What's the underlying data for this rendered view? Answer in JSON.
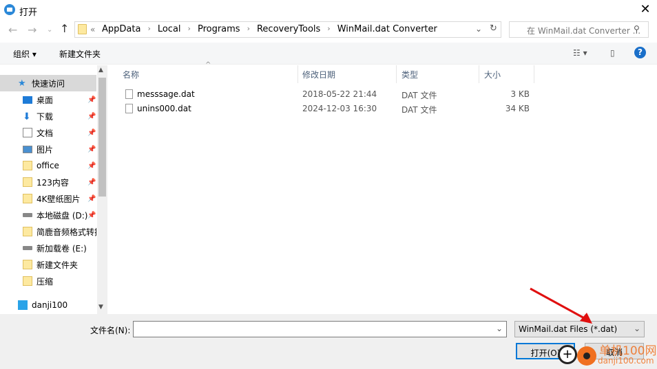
{
  "window": {
    "title": "打开",
    "close": "✕"
  },
  "address": {
    "prefix": "«",
    "crumbs": [
      "AppData",
      "Local",
      "Programs",
      "RecoveryTools",
      "WinMail.dat Converter"
    ],
    "search_placeholder": "在 WinMail.dat Converter ..."
  },
  "toolbar": {
    "organize": "组织 ▾",
    "new_folder": "新建文件夹"
  },
  "sidebar": {
    "items": [
      {
        "label": "快速访问",
        "icon": "star-icon",
        "pinned": false
      },
      {
        "label": "桌面",
        "icon": "desktop-icon",
        "pinned": true
      },
      {
        "label": "下载",
        "icon": "download-icon",
        "pinned": true
      },
      {
        "label": "文档",
        "icon": "document-icon",
        "pinned": true
      },
      {
        "label": "图片",
        "icon": "picture-icon",
        "pinned": true
      },
      {
        "label": "office",
        "icon": "folder-icon",
        "pinned": true
      },
      {
        "label": "123内容",
        "icon": "folder-icon",
        "pinned": true
      },
      {
        "label": "4K壁纸图片",
        "icon": "folder-icon",
        "pinned": true
      },
      {
        "label": "本地磁盘 (D:)",
        "icon": "drive-icon",
        "pinned": true
      },
      {
        "label": "简鹿音频格式转换",
        "icon": "folder-icon",
        "pinned": false
      },
      {
        "label": "新加载卷 (E:)",
        "icon": "drive-icon",
        "pinned": false
      },
      {
        "label": "新建文件夹",
        "icon": "folder-icon",
        "pinned": false
      },
      {
        "label": "压缩",
        "icon": "folder-icon",
        "pinned": false
      },
      {
        "label": "danji100",
        "icon": "cloud-icon",
        "pinned": false
      }
    ]
  },
  "columns": [
    "名称",
    "修改日期",
    "类型",
    "大小"
  ],
  "files": [
    {
      "name": "messsage.dat",
      "date": "2018-05-22 21:44",
      "type": "DAT 文件",
      "size": "3 KB"
    },
    {
      "name": "unins000.dat",
      "date": "2024-12-03 16:30",
      "type": "DAT 文件",
      "size": "34 KB"
    }
  ],
  "footer": {
    "filename_label": "文件名(N):",
    "filename_value": "",
    "filetype": "WinMail.dat Files (*.dat)",
    "open": "打开(O)",
    "cancel": "取消"
  },
  "watermark": {
    "text": "单机100网",
    "url": "danji100.com"
  },
  "colors": {
    "accent": "#0078d7",
    "arrow": "#e01010",
    "watermark": "#f07020"
  }
}
